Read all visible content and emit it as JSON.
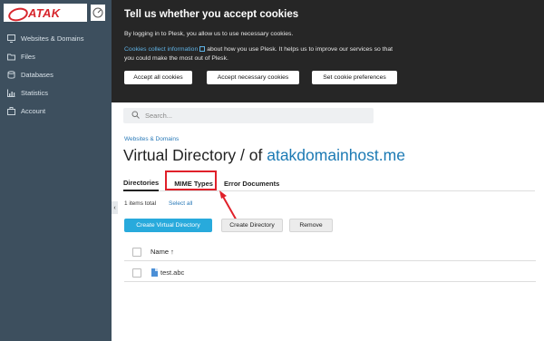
{
  "brand": {
    "logo_text": "ATAK"
  },
  "sidebar": {
    "items": [
      {
        "label": "Websites & Domains",
        "icon": "monitor-icon"
      },
      {
        "label": "Files",
        "icon": "folder-icon"
      },
      {
        "label": "Databases",
        "icon": "database-icon"
      },
      {
        "label": "Statistics",
        "icon": "chart-icon"
      },
      {
        "label": "Account",
        "icon": "briefcase-icon"
      }
    ]
  },
  "cookie": {
    "title": "Tell us whether you accept cookies",
    "line1": "By logging in to Plesk, you allow us to use necessary cookies.",
    "link": "Cookies collect information",
    "line2a": "about how you use Plesk. It helps us to improve our services so that",
    "line2b": "you could make the most out of Plesk.",
    "buttons": {
      "accept_all": "Accept all cookies",
      "accept_necessary": "Accept necessary cookies",
      "preferences": "Set cookie preferences"
    }
  },
  "search": {
    "placeholder": "Search..."
  },
  "breadcrumb": "Websites & Domains",
  "page_title": {
    "prefix": "Virtual Directory / of",
    "domain": "atakdomainhost.me"
  },
  "tabs": [
    "Directories",
    "MIME Types",
    "Error Documents"
  ],
  "list": {
    "items_total": "1 items total",
    "select_all": "Select all",
    "buttons": {
      "create_virtual": "Create Virtual Directory",
      "create_directory": "Create Directory",
      "remove": "Remove"
    },
    "column_name": "Name ↑",
    "rows": [
      {
        "name": "test.abc"
      }
    ]
  },
  "colors": {
    "accent": "#28aadc",
    "highlight": "#e0202a",
    "sidebar": "#3d4f5e"
  }
}
